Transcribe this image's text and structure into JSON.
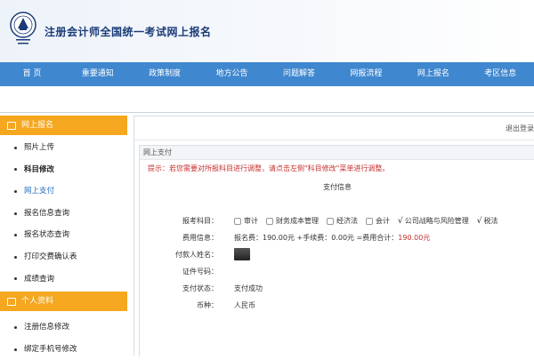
{
  "header": {
    "site_title": "注册会计师全国统一考试网上报名"
  },
  "nav": {
    "items": [
      "首 页",
      "重要通知",
      "政策制度",
      "地方公告",
      "问题解答",
      "网报流程",
      "网上报名",
      "考区信息"
    ]
  },
  "sidebar": {
    "section1_title": "网上报名",
    "section1_items": [
      "照片上传",
      "科目修改",
      "网上支付",
      "报名信息查询",
      "报名状态查询",
      "打印交费确认表",
      "成绩查询"
    ],
    "section2_title": "个人资料",
    "section2_items": [
      "注册信息修改",
      "绑定手机号修改"
    ]
  },
  "main": {
    "logout": "退出登录",
    "panel_title": "网上支付",
    "tip": "提示：若您需要对所报科目进行调整，请点击左侧\"科目修改\"菜单进行调整。",
    "info_title": "支付信息",
    "labels": {
      "subjects": "报考科目：",
      "fee": "费用信息：",
      "payer": "付款人姓名：",
      "id_no": "证件号码：",
      "status": "支付状态：",
      "currency": "币种："
    },
    "subjects": [
      {
        "name": "审计",
        "checked": false
      },
      {
        "name": "财务成本管理",
        "checked": false
      },
      {
        "name": "经济法",
        "checked": false
      },
      {
        "name": "会计",
        "checked": false
      },
      {
        "name": "公司战略与风险管理",
        "checked": true
      },
      {
        "name": "税法",
        "checked": true
      }
    ],
    "fee_text": "报名费：190.00元 +手续费：0.00元 =费用合计：",
    "fee_total": "190.00元",
    "status": "支付成功",
    "currency": "人民币"
  },
  "colors": {
    "nav": "#3f87cf",
    "sidebar_header": "#f4a71f",
    "alert": "#c62f2f",
    "link_active": "#2a6fc0"
  }
}
